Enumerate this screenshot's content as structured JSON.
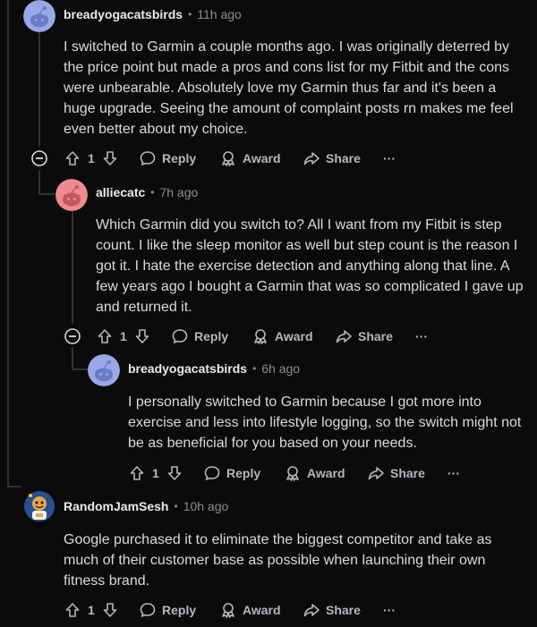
{
  "colors": {
    "background": "#0b0b0c",
    "thread_line": "#2f3236",
    "text": "#d8dadc",
    "meta": "#8a8d91",
    "action": "#b4b7bb",
    "avatar_blue": "#9aa8e6",
    "avatar_pink": "#ef8a8f"
  },
  "comments": [
    {
      "author": "breadyogacatsbirds",
      "time": "11h ago",
      "body": "I switched to Garmin a couple months ago. I was originally deterred by the price point but made a pros and cons list for my Fitbit and the cons were unbearable. Absolutely love my Garmin thus far and it's been a huge upgrade. Seeing the amount of complaint posts rn makes me feel even better about my choice.",
      "votes": "1",
      "reply_label": "Reply",
      "award_label": "Award",
      "share_label": "Share",
      "more_label": "···"
    },
    {
      "author": "alliecatc",
      "time": "7h ago",
      "body": "Which Garmin did you switch to? All I want from my Fitbit is step count. I like the sleep monitor as well but step count is the reason I got it. I hate the exercise detection and anything along that line. A few years ago I bought a Garmin that was so complicated I gave up and returned it.",
      "votes": "1",
      "reply_label": "Reply",
      "award_label": "Award",
      "share_label": "Share",
      "more_label": "···"
    },
    {
      "author": "breadyogacatsbirds",
      "time": "6h ago",
      "body": "I personally switched to Garmin because I got more into exercise and less into lifestyle logging, so the switch might not be as beneficial for you based on your needs.",
      "votes": "1",
      "reply_label": "Reply",
      "award_label": "Award",
      "share_label": "Share",
      "more_label": "···"
    },
    {
      "author": "RandomJamSesh",
      "time": "10h ago",
      "body": "Google purchased it to eliminate the biggest competitor and take as much of their customer base as possible when launching their own fitness brand.",
      "votes": "1",
      "reply_label": "Reply",
      "award_label": "Award",
      "share_label": "Share",
      "more_label": "···"
    }
  ]
}
